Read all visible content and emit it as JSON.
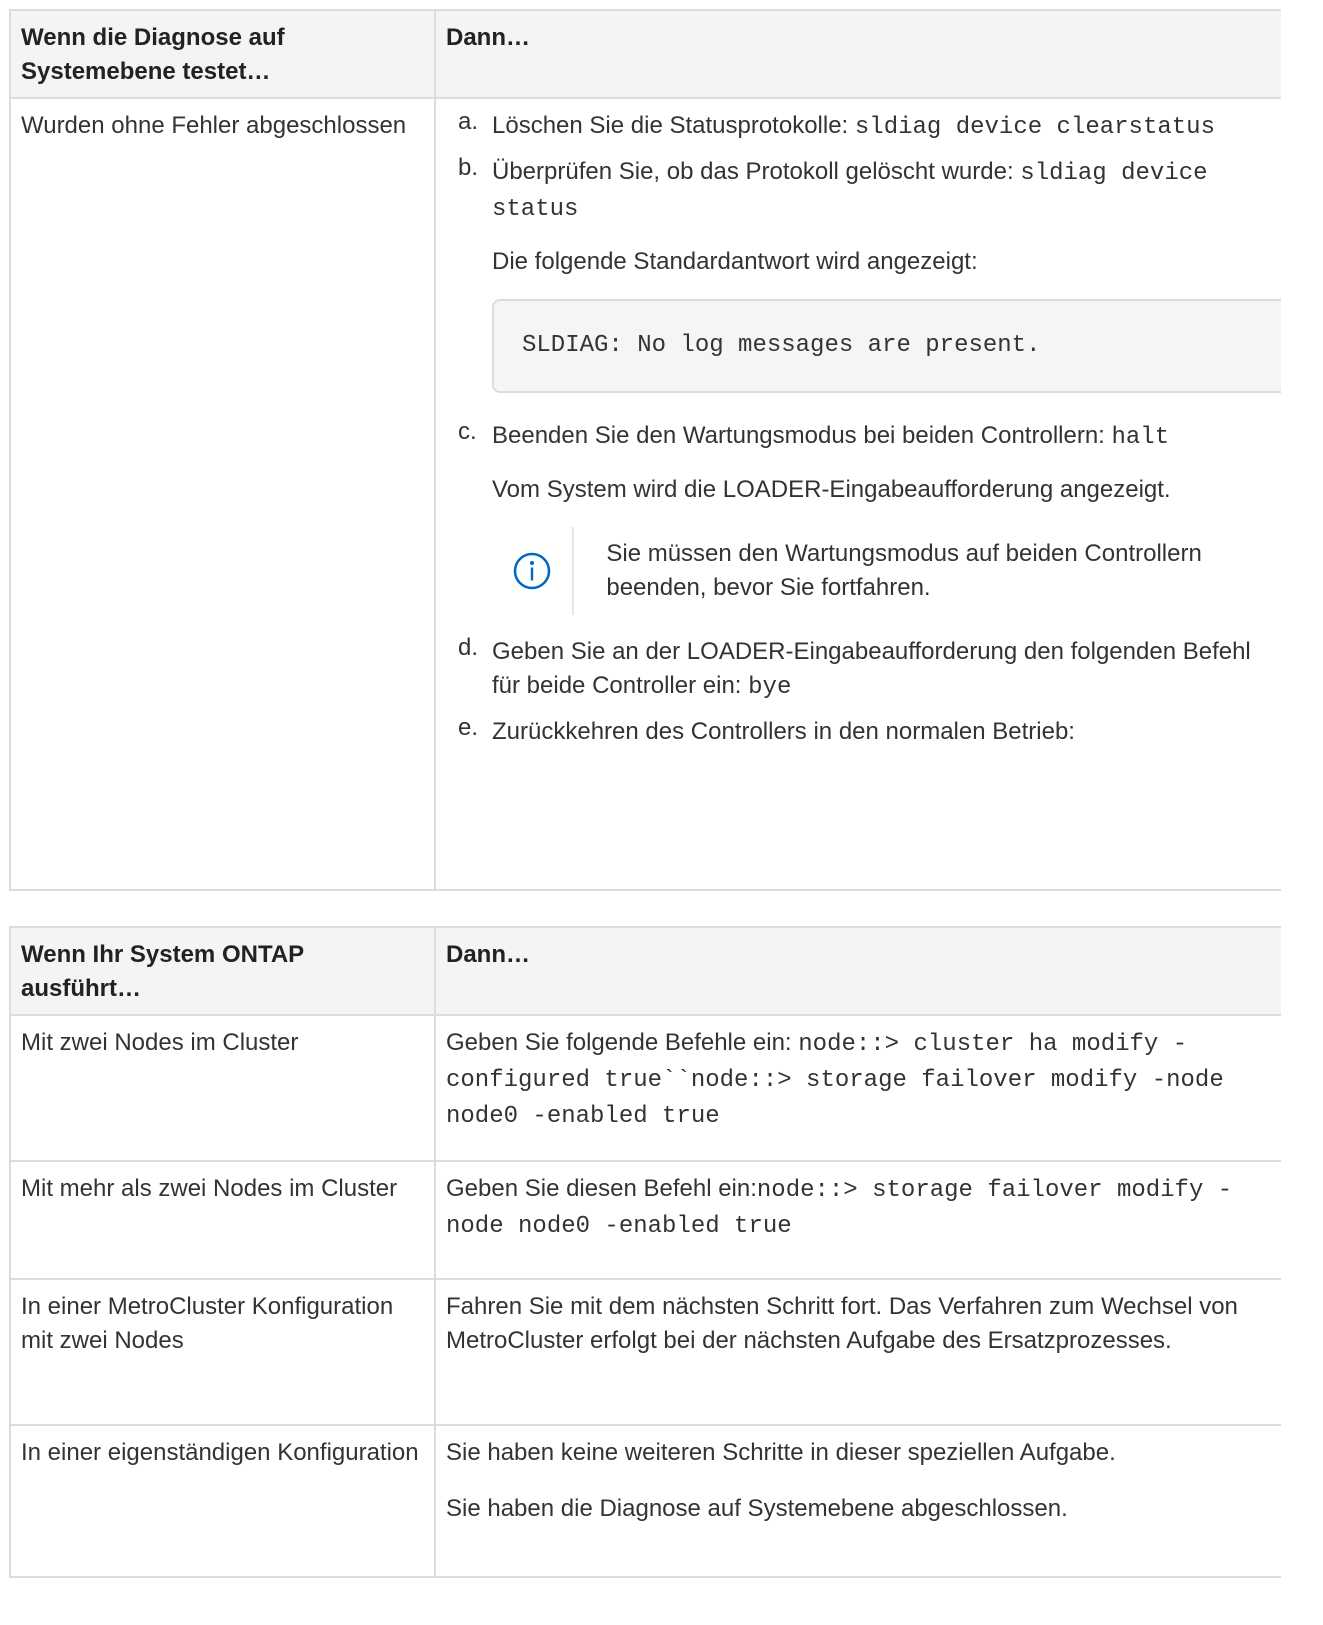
{
  "table1": {
    "header": [
      "Wenn die Diagnose auf Systemebene testet…",
      "Dann…"
    ],
    "row_label": "Wurden ohne Fehler abgeschlossen",
    "steps": [
      {
        "marker": "a.",
        "text": "Löschen Sie die Statusprotokolle: ",
        "code": "sldiag device clearstatus"
      },
      {
        "marker": "b.",
        "text": "Überprüfen Sie, ob das Protokoll gelöscht wurde: ",
        "code": "sldiag device status"
      },
      {
        "marker": "c.",
        "text": "Beenden Sie den Wartungsmodus bei beiden Controllern: ",
        "code": "halt"
      },
      {
        "marker": "d.",
        "text": "Geben Sie an der LOADER-Eingabeaufforderung den folgenden Befehl für beide Controller ein: ",
        "code": "bye"
      },
      {
        "marker": "e.",
        "text": "Zurückkehren des Controllers in den normalen Betrieb:",
        "code": ""
      }
    ],
    "step_b_note": "Die folgende Standardantwort wird angezeigt:",
    "step_b_output": "SLDIAG: No log messages are present.",
    "step_c_note": "Vom System wird die LOADER-Eingabeaufforderung angezeigt.",
    "admonition": "Sie müssen den Wartungsmodus auf beiden Controllern beenden, bevor Sie fortfahren."
  },
  "table2": {
    "header": [
      "Wenn Ihr System ONTAP ausführt…",
      "Dann…"
    ],
    "rows": [
      {
        "label": "Mit zwei Nodes im Cluster",
        "text": "Geben Sie folgende Befehle ein: ",
        "code": "node::> cluster ha modify -configured true``node::> storage failover modify -node node0 -enabled true"
      },
      {
        "label": "Mit mehr als zwei Nodes im Cluster",
        "text": "Geben Sie diesen Befehl ein:",
        "code": "node::> storage failover modify -node node0 -enabled true"
      },
      {
        "label": "In einer MetroCluster Konfiguration mit zwei Nodes",
        "text": "Fahren Sie mit dem nächsten Schritt fort. Das Verfahren zum Wechsel von MetroCluster erfolgt bei der nächsten Aufgabe des Ersatzprozesses.",
        "code": ""
      },
      {
        "label": "In einer eigenständigen Konfiguration",
        "text": "Sie haben keine weiteren Schritte in dieser speziellen Aufgabe.",
        "text2": "Sie haben die Diagnose auf Systemebene abgeschlossen."
      }
    ]
  },
  "icons": {
    "admonition": "info-circle-icon"
  },
  "colors": {
    "accent": "#0067c5",
    "border": "#dcdcdc",
    "header_bg": "#f4f4f4",
    "code_bg": "#f5f5f5"
  }
}
